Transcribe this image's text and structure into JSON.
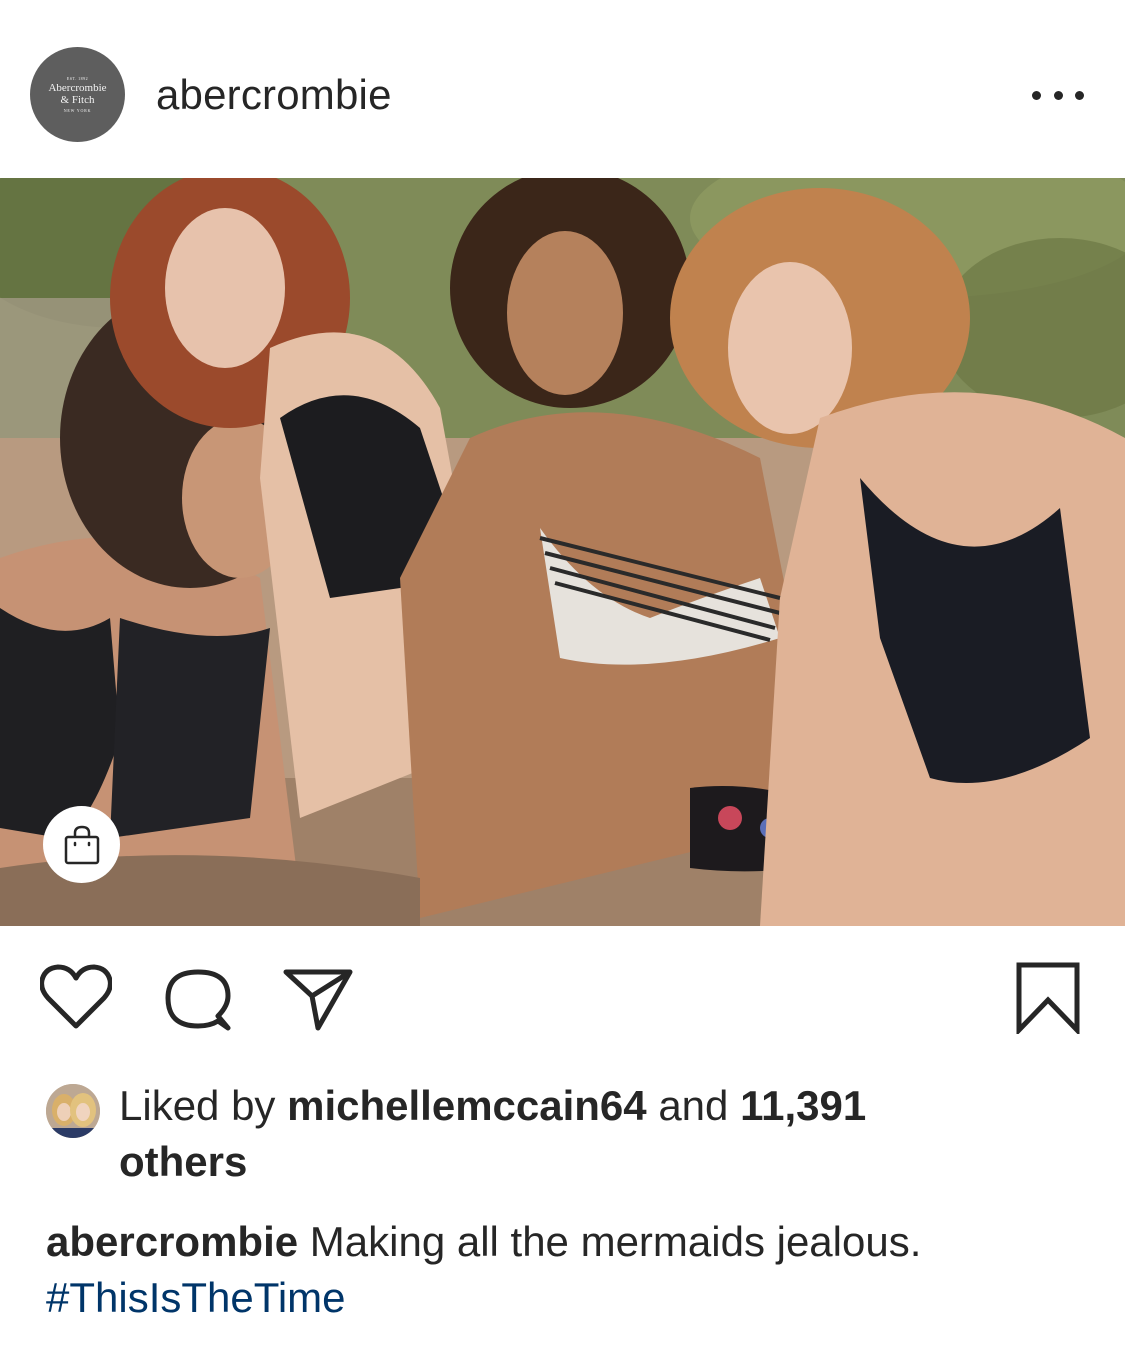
{
  "header": {
    "avatar": {
      "est": "EST. 1892",
      "brand_line1": "Abercrombie",
      "brand_line2": "& Fitch",
      "city": "NEW YORK"
    },
    "username": "abercrombie",
    "more_icon": "more-horizontal-icon"
  },
  "post": {
    "image_alt": "Four women in swimwear sitting together outdoors",
    "shop_icon": "shopping-bag-icon"
  },
  "actions": {
    "like_icon": "heart-icon",
    "comment_icon": "comment-icon",
    "share_icon": "paper-plane-icon",
    "save_icon": "bookmark-icon"
  },
  "likes": {
    "prefix": "Liked by ",
    "user": "michellemccain64",
    "middle": " and ",
    "count": "11,391",
    "line2": "others"
  },
  "caption": {
    "username": "abercrombie",
    "text": " Making all the mermaids jealous.",
    "hashtag": "#ThisIsTheTime"
  },
  "colors": {
    "text": "#262626",
    "hashtag": "#003569",
    "avatar_bg": "#5e5e5e"
  }
}
